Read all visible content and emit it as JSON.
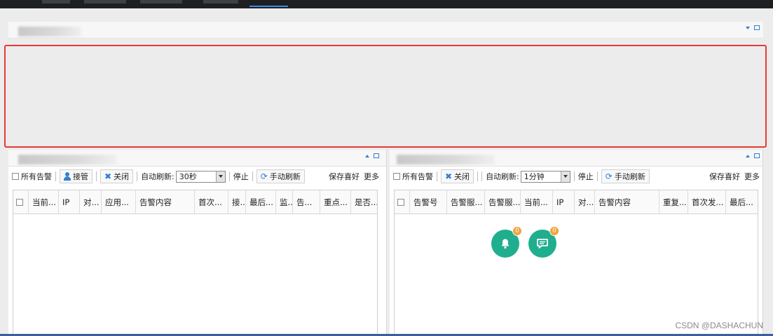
{
  "top_panel": {},
  "left_pane": {
    "toolbar": {
      "all_alerts": "所有告警",
      "takeover": "接管",
      "close": "关闭",
      "auto_refresh_label": "自动刷新:",
      "auto_refresh_value": "30秒",
      "stop": "停止",
      "manual_refresh": "手动刷新",
      "save_preference": "保存喜好",
      "more": "更多"
    },
    "columns": [
      "当前...",
      "IP",
      "对...",
      "应用...",
      "告警内容",
      "首次...",
      "接...",
      "最后...",
      "监...",
      "告...",
      "重点...",
      "是否..."
    ]
  },
  "right_pane": {
    "toolbar": {
      "all_alerts": "所有告警",
      "close": "关闭",
      "auto_refresh_label": "自动刷新:",
      "auto_refresh_value": "1分钟",
      "stop": "停止",
      "manual_refresh": "手动刷新",
      "save_preference": "保存喜好",
      "more": "更多"
    },
    "columns": [
      "告警号",
      "告警服...",
      "告警服...",
      "当前...",
      "IP",
      "对...",
      "告警内容",
      "重复...",
      "首次发...",
      "最后..."
    ],
    "fab_alerts": {
      "icon": "bell-icon",
      "badge": "0"
    },
    "fab_messages": {
      "icon": "message-icon",
      "badge": "0"
    }
  },
  "colors": {
    "accent": "#2f7fd6",
    "fab": "#1fae8e",
    "badge": "#f2a23a",
    "highlight_border": "#e53935"
  },
  "watermark": "CSDN @DASHACHUN"
}
